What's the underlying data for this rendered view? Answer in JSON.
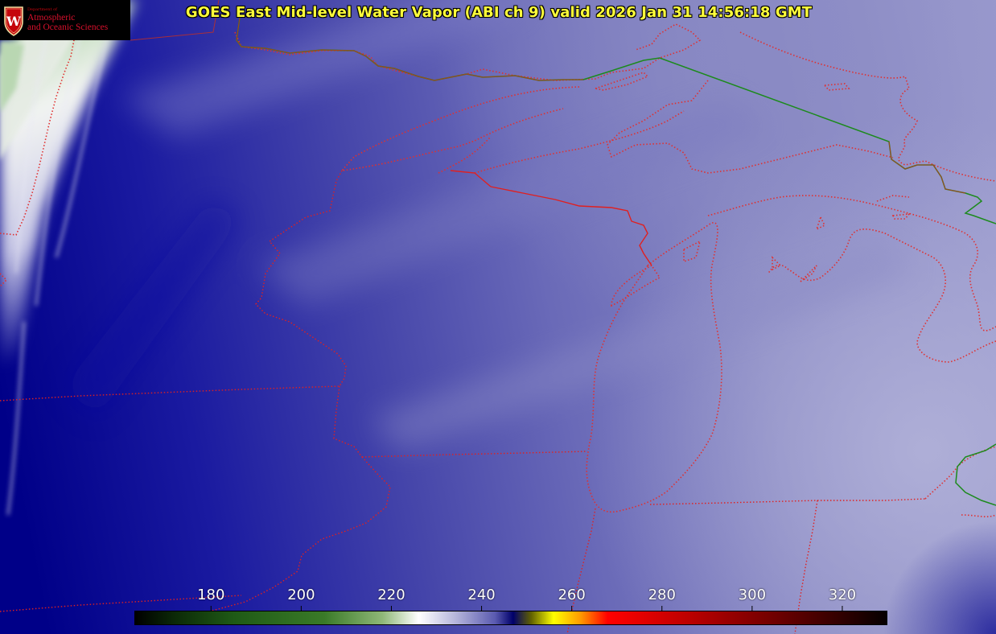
{
  "header": {
    "title": "GOES East Mid-level Water Vapor (ABI ch 9)  valid 2026 Jan 31 14:56:18 GMT"
  },
  "logo": {
    "dept_text": "Department of",
    "line1": "Atmospheric",
    "line2": "and Oceanic Sciences",
    "crest_letter": "W",
    "crest_color": "#c5050c"
  },
  "colorbar": {
    "ticks": [
      "180",
      "200",
      "220",
      "240",
      "260",
      "280",
      "300",
      "320"
    ],
    "tick_values": [
      180,
      200,
      220,
      240,
      260,
      280,
      300,
      320
    ],
    "range": [
      163,
      330
    ],
    "color_stops": [
      {
        "value": 163,
        "color": "#000000"
      },
      {
        "value": 172,
        "color": "#0c2a08"
      },
      {
        "value": 185,
        "color": "#1f5a16"
      },
      {
        "value": 205,
        "color": "#3a7a28"
      },
      {
        "value": 218,
        "color": "#8fb878"
      },
      {
        "value": 226,
        "color": "#ffffff"
      },
      {
        "value": 234,
        "color": "#b8b8dc"
      },
      {
        "value": 243,
        "color": "#5a5ab0"
      },
      {
        "value": 247,
        "color": "#00006a"
      },
      {
        "value": 251,
        "color": "#606000"
      },
      {
        "value": 256,
        "color": "#ffff00"
      },
      {
        "value": 262,
        "color": "#ff9a00"
      },
      {
        "value": 268,
        "color": "#ff0000"
      },
      {
        "value": 285,
        "color": "#c00000"
      },
      {
        "value": 305,
        "color": "#700000"
      },
      {
        "value": 330,
        "color": "#050000"
      }
    ]
  },
  "colors": {
    "title": "#ffff3a",
    "state_border": "#e02020",
    "intl_border": "#1c8a1c",
    "coast": "#e03030",
    "vapor_dark": "#000088",
    "vapor_mid": "#5a5ab0",
    "vapor_light": "#a8a8d4",
    "cloud_white": "#f2f4f2",
    "cloud_green": "#b9d7b2"
  }
}
